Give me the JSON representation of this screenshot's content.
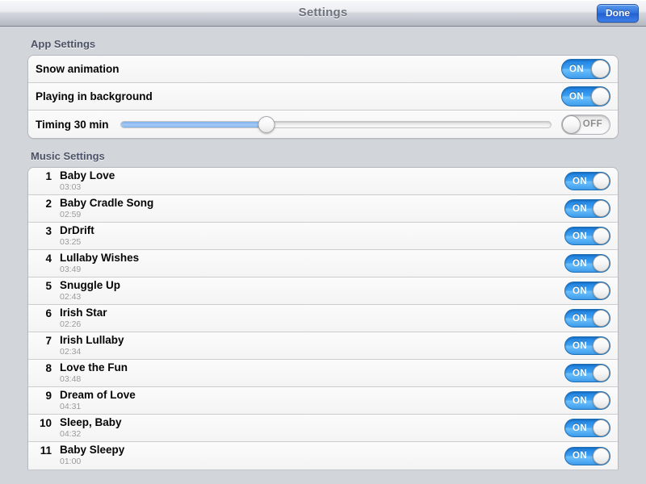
{
  "navbar": {
    "title": "Settings",
    "done_label": "Done",
    "accent_color": "#2f6fdc"
  },
  "app_settings": {
    "header": "App Settings",
    "rows": [
      {
        "label": "Snow animation",
        "type": "switch",
        "state": "ON"
      },
      {
        "label": "Playing in background",
        "type": "switch",
        "state": "ON"
      },
      {
        "label": "Timing 30 min",
        "type": "slider",
        "state": "OFF",
        "slider_percent": 34
      }
    ]
  },
  "music_settings": {
    "header": "Music Settings",
    "rows": [
      {
        "index": "1",
        "title": "Baby Love",
        "duration": "03:03",
        "state": "ON"
      },
      {
        "index": "2",
        "title": "Baby Cradle Song",
        "duration": "02:59",
        "state": "ON"
      },
      {
        "index": "3",
        "title": "DrDrift",
        "duration": "03:25",
        "state": "ON"
      },
      {
        "index": "4",
        "title": "Lullaby Wishes",
        "duration": "03:49",
        "state": "ON"
      },
      {
        "index": "5",
        "title": "Snuggle Up",
        "duration": "02:43",
        "state": "ON"
      },
      {
        "index": "6",
        "title": "Irish Star",
        "duration": "02:26",
        "state": "ON"
      },
      {
        "index": "7",
        "title": "Irish Lullaby",
        "duration": "02:34",
        "state": "ON"
      },
      {
        "index": "8",
        "title": "Love the Fun",
        "duration": "03:48",
        "state": "ON"
      },
      {
        "index": "9",
        "title": "Dream of Love",
        "duration": "04:31",
        "state": "ON"
      },
      {
        "index": "10",
        "title": "Sleep, Baby",
        "duration": "04:32",
        "state": "ON"
      },
      {
        "index": "11",
        "title": "Baby Sleepy",
        "duration": "01:00",
        "state": "ON"
      }
    ]
  }
}
